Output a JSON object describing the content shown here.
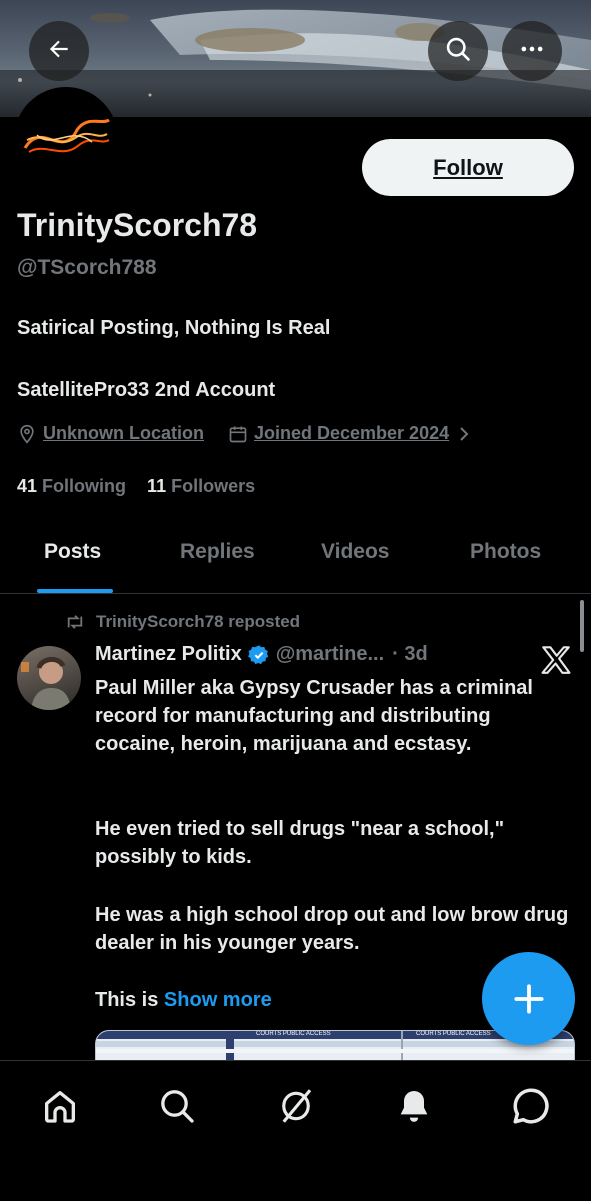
{
  "header": {
    "back_icon": "arrow-left-icon",
    "search_icon": "search-icon",
    "more_icon": "more-horizontal-icon"
  },
  "profile": {
    "follow_label": "Follow",
    "display_name": "TrinityScorch78",
    "handle": "@TScorch788",
    "bio_line1": "Satirical Posting, Nothing Is Real",
    "bio_line2": "SatellitePro33 2nd Account",
    "location": "Unknown Location",
    "joined": "Joined December 2024",
    "following_count": "41",
    "following_label": "Following",
    "followers_count": "11",
    "followers_label": "Followers"
  },
  "tabs": [
    {
      "label": "Posts",
      "active": true
    },
    {
      "label": "Replies",
      "active": false
    },
    {
      "label": "Videos",
      "active": false
    },
    {
      "label": "Photos",
      "active": false
    }
  ],
  "post": {
    "repost_text": "TrinityScorch78 reposted",
    "author_name": "Martinez Politix",
    "author_handle": "@martine...",
    "time": "· 3d",
    "paragraph1": "Paul Miller aka Gypsy Crusader has a criminal record for manufacturing and distributing cocaine, heroin, marijuana and ecstasy.",
    "paragraph2": "He even tried to sell drugs \"near a school,\" possibly to kids.",
    "paragraph3": "He was a high school drop out and low brow drug dealer in his younger years.",
    "paragraph4_prefix": "This is",
    "show_more": "Show more",
    "media_label_1": "COURTS PUBLIC ACCESS",
    "media_label_2": "COURTS PUBLIC ACCESS"
  },
  "colors": {
    "accent": "#1d9bf0",
    "background": "#000000",
    "text_primary": "#e7e9ea",
    "text_secondary": "#71767b"
  },
  "bottom_nav": [
    "home-icon",
    "search-icon",
    "grok-icon",
    "notifications-icon",
    "messages-icon"
  ]
}
